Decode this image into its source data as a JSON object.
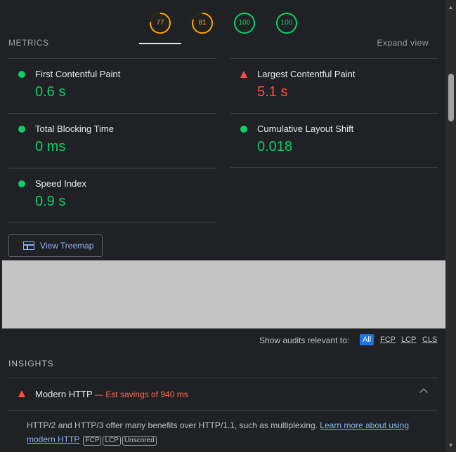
{
  "gauges": [
    {
      "value": "77",
      "score": 0.77,
      "color": "#ffa400"
    },
    {
      "value": "81",
      "score": 0.81,
      "color": "#ffa400"
    },
    {
      "value": "100",
      "score": 1.0,
      "color": "#0cce6b"
    },
    {
      "value": "100",
      "score": 1.0,
      "color": "#0cce6b"
    }
  ],
  "metrics_header": {
    "title": "METRICS",
    "expand": "Expand view"
  },
  "metrics": {
    "fcp": {
      "label": "First Contentful Paint",
      "value": "0.6 s",
      "status": "pass",
      "color": "#0cce6b"
    },
    "lcp": {
      "label": "Largest Contentful Paint",
      "value": "5.1 s",
      "status": "fail",
      "color": "#ff4e42"
    },
    "tbt": {
      "label": "Total Blocking Time",
      "value": "0 ms",
      "status": "pass",
      "color": "#0cce6b"
    },
    "cls": {
      "label": "Cumulative Layout Shift",
      "value": "0.018",
      "status": "pass",
      "color": "#0cce6b"
    },
    "si": {
      "label": "Speed Index",
      "value": "0.9 s",
      "status": "pass",
      "color": "#0cce6b"
    }
  },
  "treemap_button": {
    "label": "View Treemap",
    "icon": "treemap-icon"
  },
  "filter": {
    "label": "Show audits relevant to:",
    "options": [
      "All",
      "FCP",
      "LCP",
      "CLS"
    ],
    "active": "All"
  },
  "insights": {
    "title": "INSIGHTS",
    "audit": {
      "name": "Modern HTTP",
      "savings": "— Est savings of 940 ms",
      "description": "HTTP/2 and HTTP/3 offer many benefits over HTTP/1.1, such as multiplexing.",
      "link_text": "Learn more about using modern HTTP",
      "tags": [
        "FCP",
        "LCP",
        "Unscored"
      ]
    }
  }
}
